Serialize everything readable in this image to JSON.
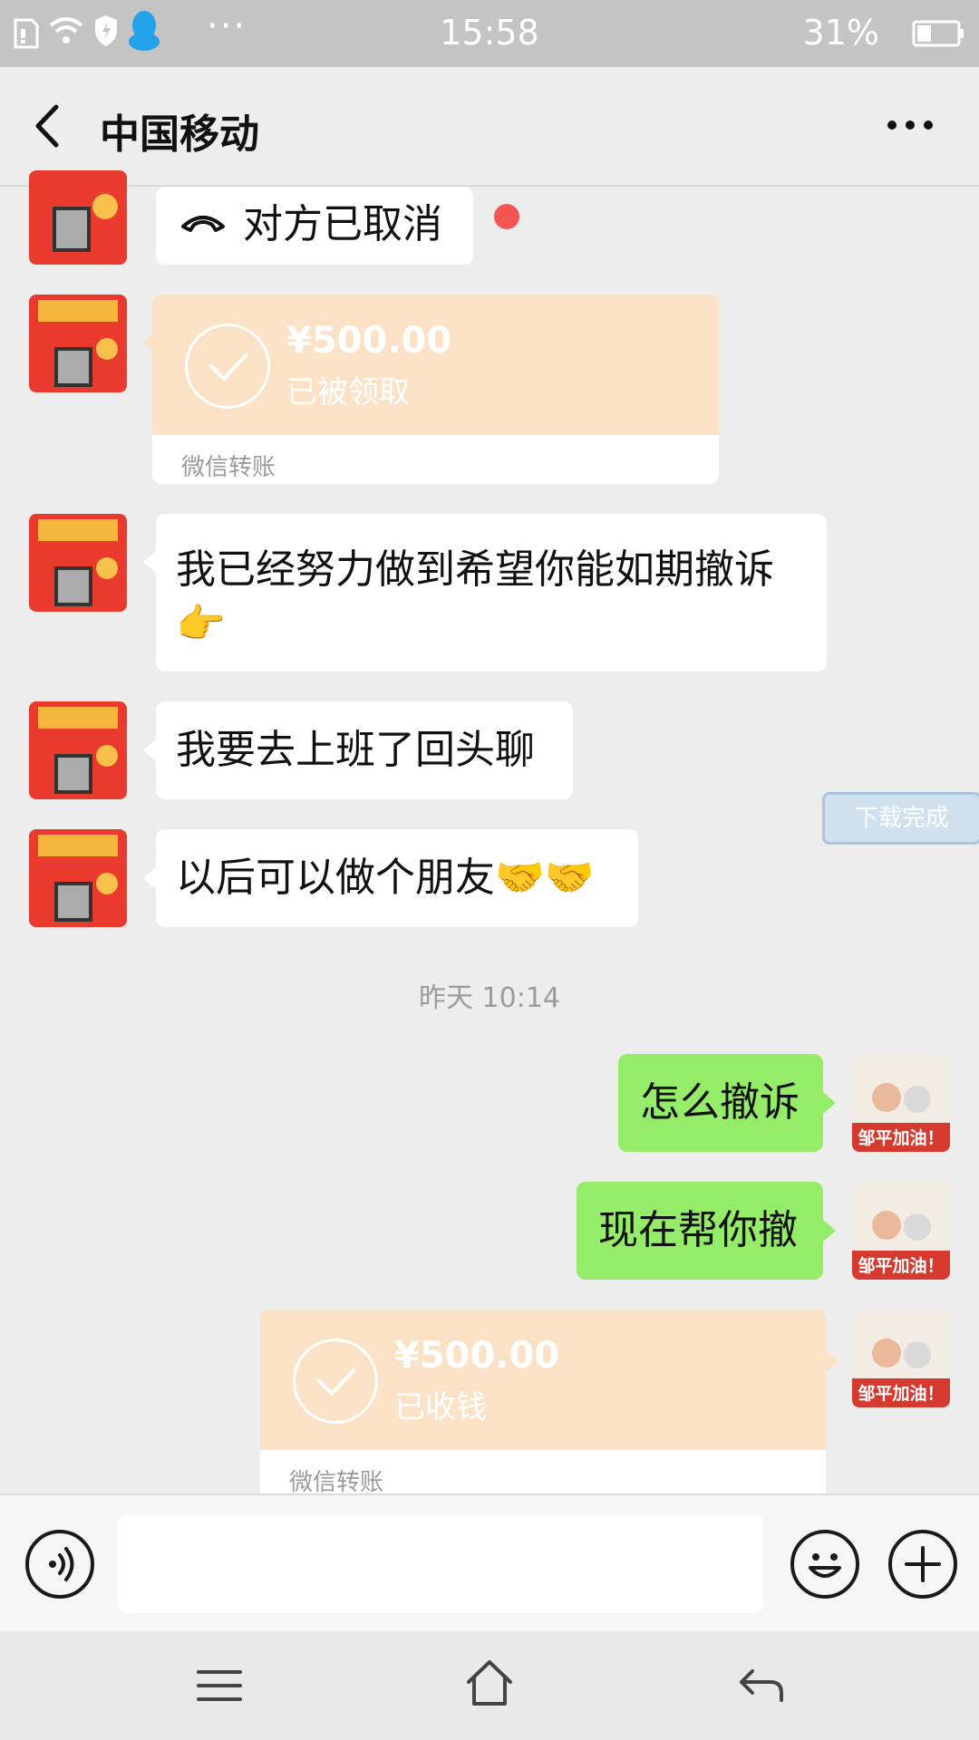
{
  "status_bar": {
    "time": "15:58",
    "battery": "31%",
    "more": "···"
  },
  "header": {
    "title": "中国移动"
  },
  "messages": {
    "call": {
      "text": "对方已取消"
    },
    "transfer1": {
      "amount": "¥500.00",
      "status": "已被领取",
      "label": "微信转账"
    },
    "msg3": {
      "line1": "我已经努力做到希望你能如期撤诉",
      "line2": "👉"
    },
    "msg4": {
      "text": "我要去上班了回头聊"
    },
    "msg5": {
      "text": "以后可以做个朋友🤝🤝"
    },
    "timestamp": "昨天 10:14",
    "msg6": {
      "text": "怎么撤诉"
    },
    "msg7": {
      "text": "现在帮你撤"
    },
    "transfer2": {
      "amount": "¥500.00",
      "status": "已收钱",
      "label": "微信转账"
    }
  },
  "download_tag": "下载完成",
  "avatar_right_caption": "邹平加油！",
  "icons": {
    "back": "chevron-left-icon",
    "more": "more-dots-icon",
    "voice": "voice-icon",
    "emoji": "emoji-icon",
    "plus": "plus-icon",
    "menu": "menu-icon",
    "home": "home-icon",
    "return": "back-arrow-icon"
  },
  "colors": {
    "green_bubble": "#95ec69",
    "transfer_card": "#fbe2c6",
    "red_dot": "#f45454",
    "background": "#ededed"
  }
}
